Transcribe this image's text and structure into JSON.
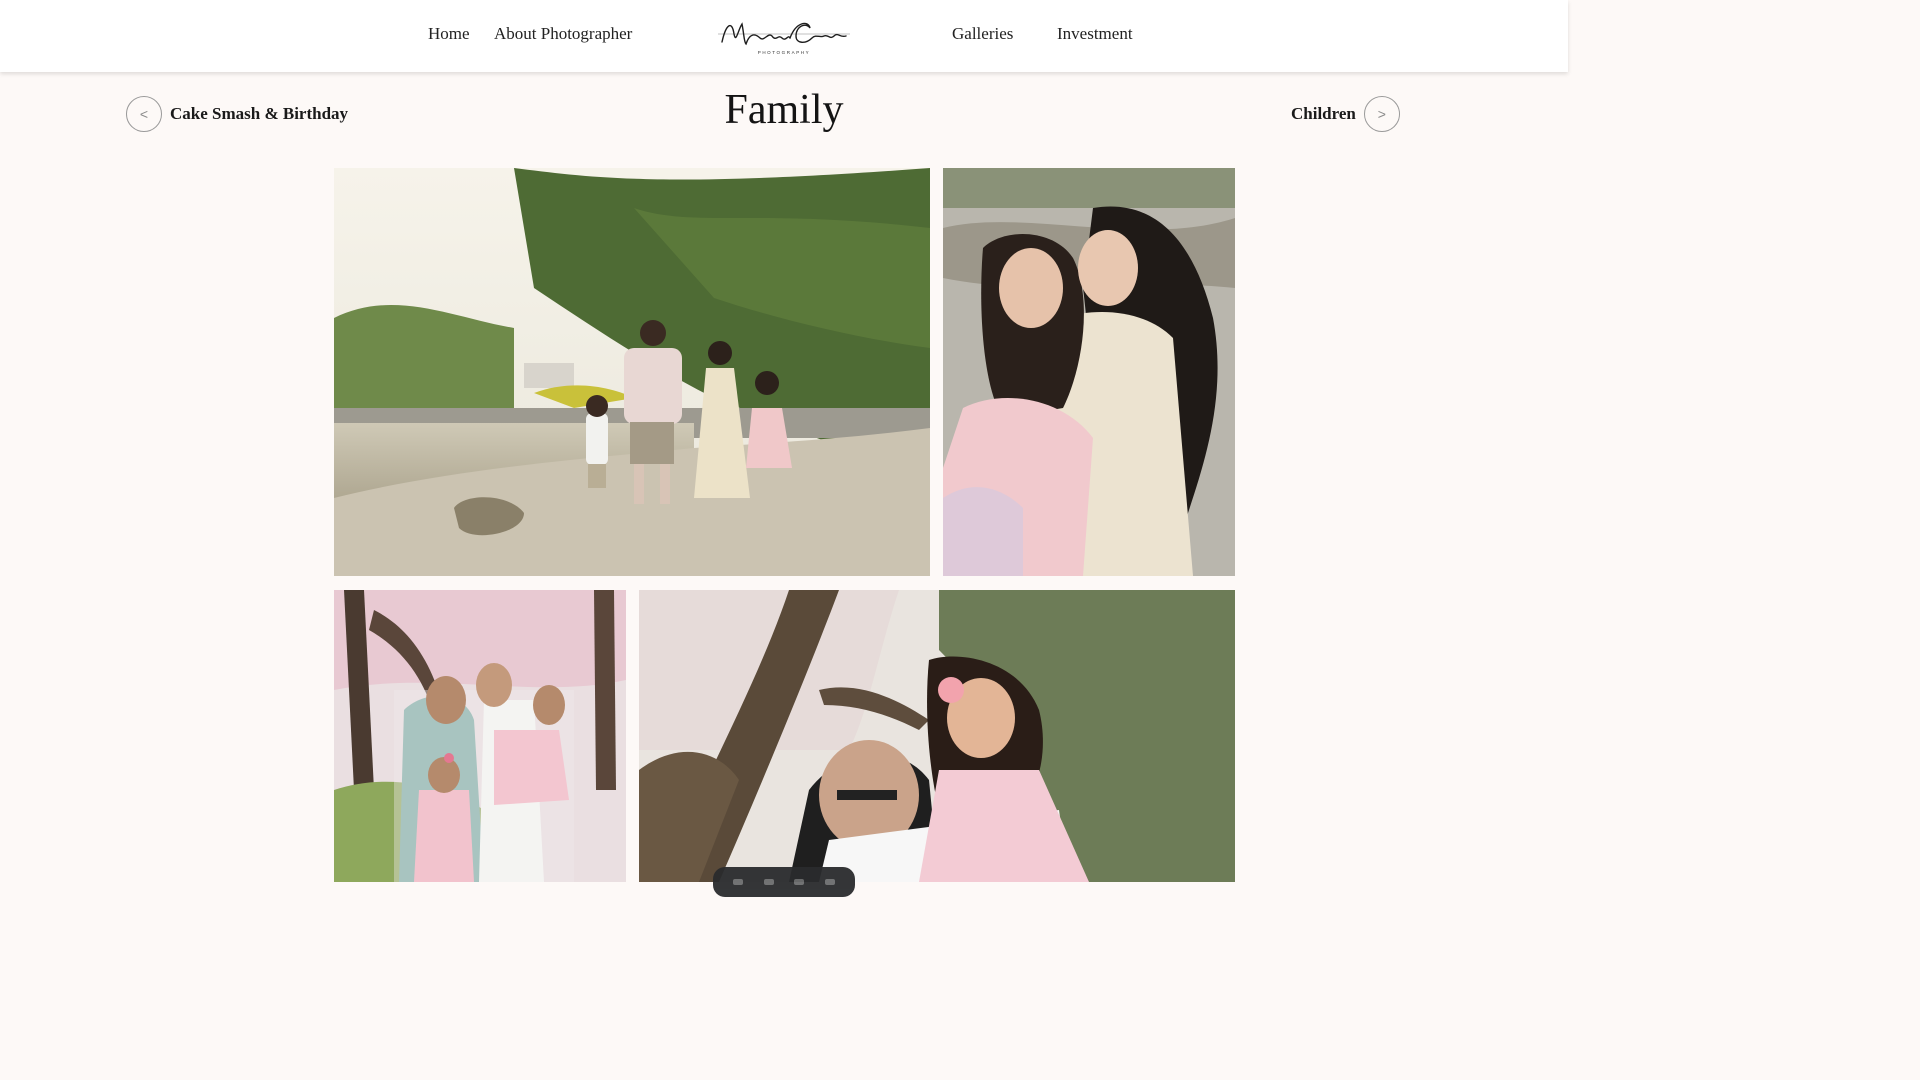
{
  "header": {
    "nav_left": [
      "Home",
      "About Photographer"
    ],
    "nav_right": [
      "Galleries",
      "Investment"
    ],
    "logo_text": "Magnolia Coasts",
    "logo_subtext": "PHOTOGRAPHY"
  },
  "gallery": {
    "title": "Family",
    "prev": {
      "label": "Cake Smash & Birthday",
      "arrow": "<"
    },
    "next": {
      "label": "Children",
      "arrow": ">"
    }
  },
  "photos": [
    {
      "name": "family-walking-by-lake-photo",
      "icon": "photo"
    },
    {
      "name": "mother-daughter-hug-photo",
      "icon": "photo"
    },
    {
      "name": "family-cherry-blossom-portrait-photo",
      "icon": "photo"
    },
    {
      "name": "father-lifting-daughter-photo",
      "icon": "photo"
    }
  ],
  "colors": {
    "page_bg": "#fdf9f7",
    "header_bg": "#ffffff",
    "text": "#1a1a1a",
    "circle_border": "#9a9a9a"
  }
}
